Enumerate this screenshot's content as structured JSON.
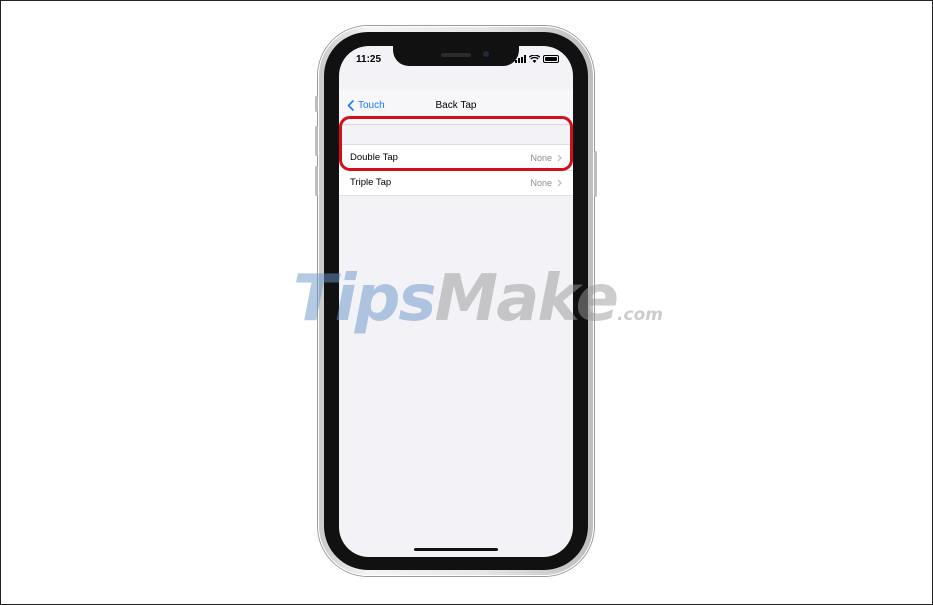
{
  "status_bar": {
    "time": "11:25"
  },
  "nav": {
    "back_label": "Touch",
    "title": "Back Tap"
  },
  "settings": [
    {
      "label": "Double Tap",
      "value": "None"
    },
    {
      "label": "Triple Tap",
      "value": "None"
    }
  ],
  "watermark": {
    "part1": "Tips",
    "part2": "Make",
    "part3": ".com"
  },
  "colors": {
    "accent": "#1a7aff",
    "highlight": "#d0101a",
    "background": "#f2f2f7"
  }
}
